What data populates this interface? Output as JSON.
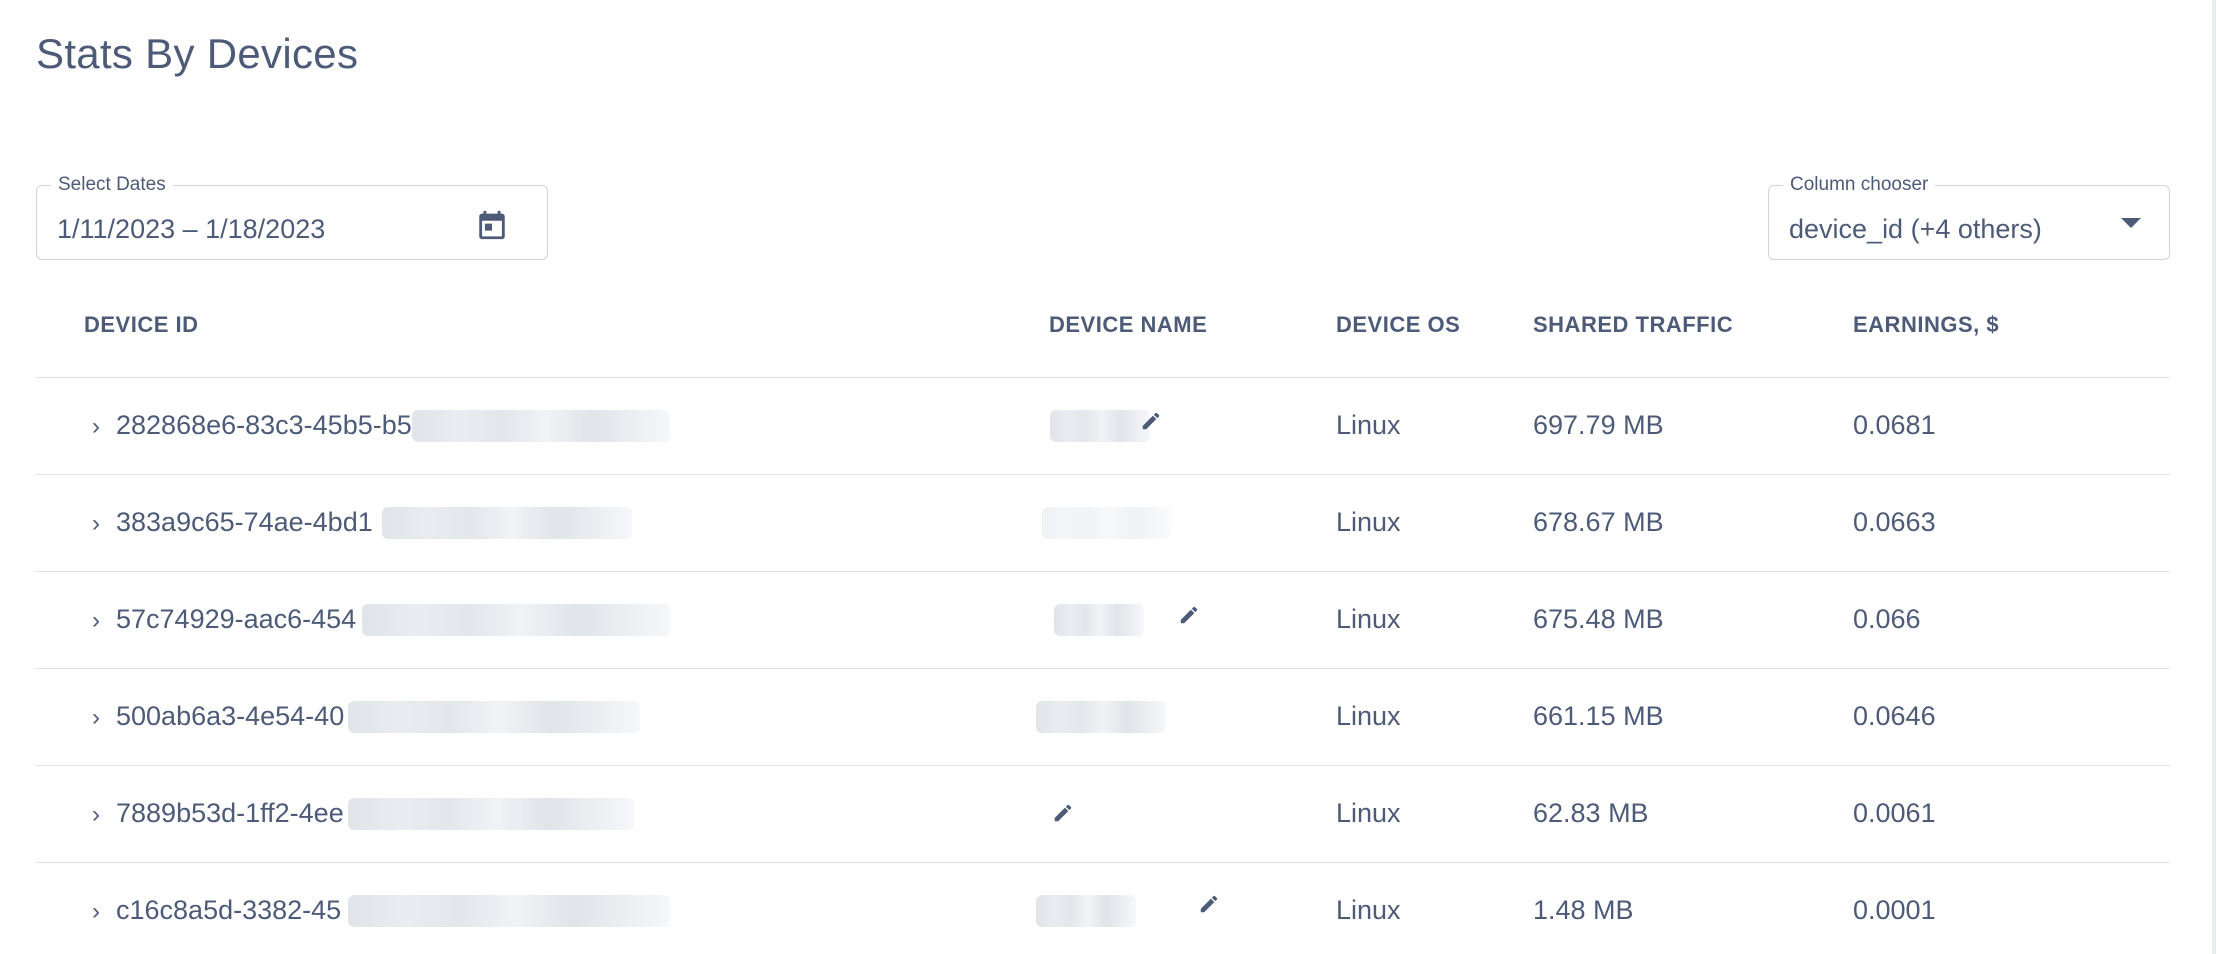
{
  "page": {
    "title": "Stats By Devices"
  },
  "date_picker": {
    "label": "Select Dates",
    "value": "1/11/2023 – 1/18/2023",
    "icon": "calendar-icon"
  },
  "column_chooser": {
    "label": "Column chooser",
    "value": "device_id (+4 others)",
    "icon": "caret-down-icon"
  },
  "table": {
    "headers": {
      "device_id": "DEVICE ID",
      "device_name": "DEVICE NAME",
      "device_os": "DEVICE OS",
      "shared_traffic": "SHARED TRAFFIC",
      "earnings": "EARNINGS, $"
    },
    "rows": [
      {
        "device_id": "282868e6-83c3-45b5-b5",
        "device_os": "Linux",
        "shared_traffic": "697.79 MB",
        "earnings": "0.0681"
      },
      {
        "device_id": "383a9c65-74ae-4bd1",
        "device_os": "Linux",
        "shared_traffic": "678.67 MB",
        "earnings": "0.0663"
      },
      {
        "device_id": "57c74929-aac6-454",
        "device_os": "Linux",
        "shared_traffic": "675.48 MB",
        "earnings": "0.066"
      },
      {
        "device_id": "500ab6a3-4e54-40",
        "device_os": "Linux",
        "shared_traffic": "661.15 MB",
        "earnings": "0.0646"
      },
      {
        "device_id": "7889b53d-1ff2-4ee",
        "device_os": "Linux",
        "shared_traffic": "62.83 MB",
        "earnings": "0.0061"
      },
      {
        "device_id": "c16c8a5d-3382-45",
        "device_os": "Linux",
        "shared_traffic": "1.48 MB",
        "earnings": "0.0001"
      }
    ]
  },
  "icons": {
    "expand": "chevron-right-icon",
    "edit": "pencil-icon"
  },
  "colors": {
    "text": "#4d5b78",
    "border": "#cfd4dd",
    "divider": "#dfe3ea"
  }
}
